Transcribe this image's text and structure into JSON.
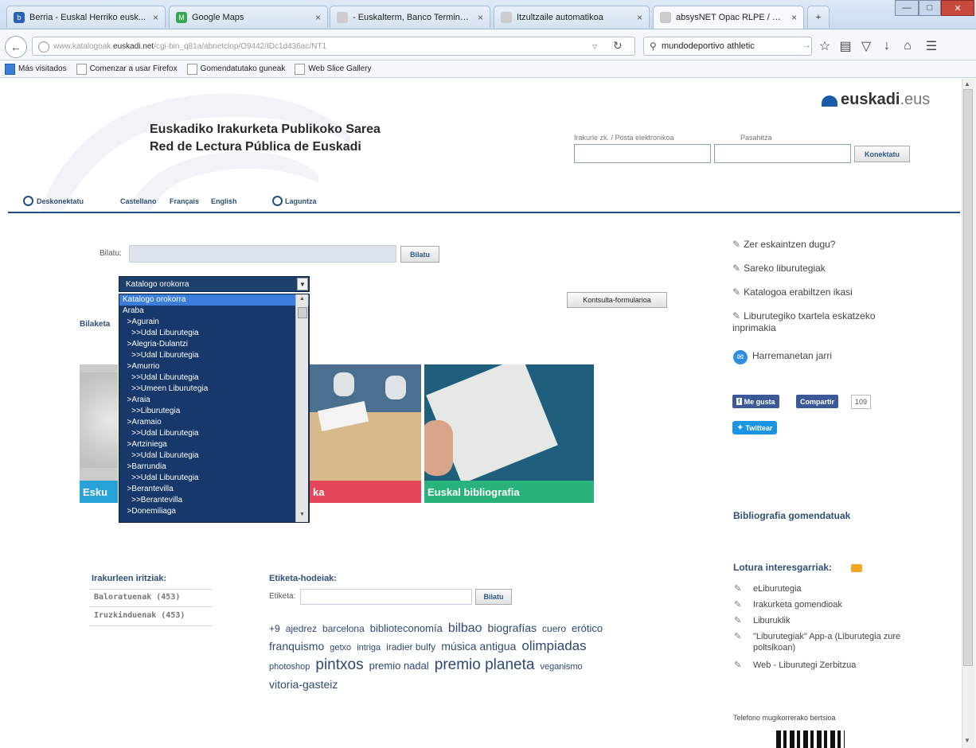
{
  "browser": {
    "tabs": [
      {
        "label": "Berria - Euskal Herriko eusk...",
        "fav_color": "#2a62b8",
        "fav_char": "b"
      },
      {
        "label": "Google Maps",
        "fav_color": "#34a853",
        "fav_char": "M"
      },
      {
        "label": "- Euskalterm, Banco Terminoló...",
        "fav_color": "#cccccc",
        "fav_char": ""
      },
      {
        "label": "Itzultzaile automatikoa",
        "fav_color": "#cccccc",
        "fav_char": ""
      },
      {
        "label": "absysNET Opac RLPE / EIPS",
        "fav_color": "#cccccc",
        "fav_char": ""
      }
    ],
    "new_tab": "+",
    "url_host": "www.katalogoak.euskadi.net",
    "url_path": "/cgi-bin_q81a/abnetclop/O9442/IDc1d436ac/NT1",
    "url_domain_bold": "euskadi.net",
    "url_prefix": "www.katalogoak.",
    "url_suffix": "/cgi-bin_q81a/abnetclop/O9442/IDc1d436ac/NT1",
    "search_value": "mundodeportivo athletic",
    "bookmarks": [
      "Más visitados",
      "Comenzar a usar Firefox",
      "Gomendatutako guneak",
      "Web Slice Gallery"
    ]
  },
  "header": {
    "logo_main": "euskadi",
    "logo_suffix": ".eus",
    "title_line1": "Euskadiko Irakurketa Publikoko Sarea",
    "title_line2": "Red de Lectura Pública de Euskadi",
    "login_label": "Irakurle zk. / Posta elektronikoa",
    "password_label": "Pasahitza",
    "connect_button": "Konektatu",
    "disconnect": "Deskonektatu",
    "languages": [
      "Castellano",
      "Français",
      "English"
    ],
    "help": "Laguntza"
  },
  "search": {
    "label": "Bilatu:",
    "button": "Bilatu",
    "form_button": "Kontsulta-formularioa",
    "left_label": "Bilaketa"
  },
  "dropdown": {
    "selected": "Katalogo orokorra",
    "options": [
      "Katalogo orokorra",
      "Araba",
      "  >Agurain",
      "    >>Udal Liburutegia",
      "  >Alegria-Dulantzi",
      "    >>Udal Liburutegia",
      "  >Amurrio",
      "    >>Udal Liburutegia",
      "    >>Umeen Liburutegia",
      "  >Araia",
      "    >>Liburutegia",
      "  >Aramaio",
      "    >>Udal Liburutegia",
      "  >Artziniega",
      "    >>Udal Liburutegia",
      "  >Barrundia",
      "    >>Udal Liburutegia",
      "  >Berantevilla",
      "    >>Berantevilla",
      "  >Donemiliaga"
    ]
  },
  "cards": [
    {
      "caption": "Esku",
      "color": "#27a3d9"
    },
    {
      "caption": "ka",
      "color": "#e5465a"
    },
    {
      "caption": "Euskal bibliografia",
      "color": "#27b37a"
    }
  ],
  "reviews": {
    "title": "Irakurleen iritziak:",
    "items": [
      "Baloratuenak (453)",
      "Iruzkinduenak (453)"
    ]
  },
  "tagcloud": {
    "title": "Etiketa-hodeiak:",
    "label": "Etiketa:",
    "button": "Bilatu",
    "tags": [
      {
        "t": "+9",
        "s": 12
      },
      {
        "t": "ajedrez",
        "s": 12
      },
      {
        "t": "barcelona",
        "s": 12
      },
      {
        "t": "biblioteconomía",
        "s": 13
      },
      {
        "t": "bilbao",
        "s": 16
      },
      {
        "t": "biografías",
        "s": 14
      },
      {
        "t": "cuero",
        "s": 12
      },
      {
        "t": "erótico",
        "s": 13
      },
      {
        "t": "franquismo",
        "s": 14
      },
      {
        "t": "getxo",
        "s": 11
      },
      {
        "t": "intriga",
        "s": 11
      },
      {
        "t": "iradier bulfy",
        "s": 12
      },
      {
        "t": "música antigua",
        "s": 14
      },
      {
        "t": "olimpiadas",
        "s": 17
      },
      {
        "t": "photoshop",
        "s": 11
      },
      {
        "t": "pintxos",
        "s": 19
      },
      {
        "t": "premio nadal",
        "s": 13
      },
      {
        "t": "premio planeta",
        "s": 19
      },
      {
        "t": "veganismo",
        "s": 11
      },
      {
        "t": "vitoria-gasteiz",
        "s": 14
      }
    ]
  },
  "sidebar": {
    "links": [
      "Zer eskaintzen dugu?",
      "Sareko liburutegiak",
      "Katalogoa erabiltzen ikasi",
      "Liburutegiko txartela eskatzeko inprimakia"
    ],
    "contact": "Harremanetan jarri",
    "like": "Me gusta",
    "share": "Compartir",
    "count": "109",
    "tweet": "Twittear",
    "recommended": "Bibliografia gomendatuak",
    "interesting": "Lotura interesgarriak:",
    "interesting_links": [
      "eLiburutegia",
      "Irakurketa gomendioak",
      "Liburuklik",
      "\"Liburutegiak\" App-a (Liburutegia zure poltsikoan)",
      "Web - Liburutegi Zerbitzua"
    ],
    "mobile": "Telefono mugikorrerako bertsioa"
  }
}
